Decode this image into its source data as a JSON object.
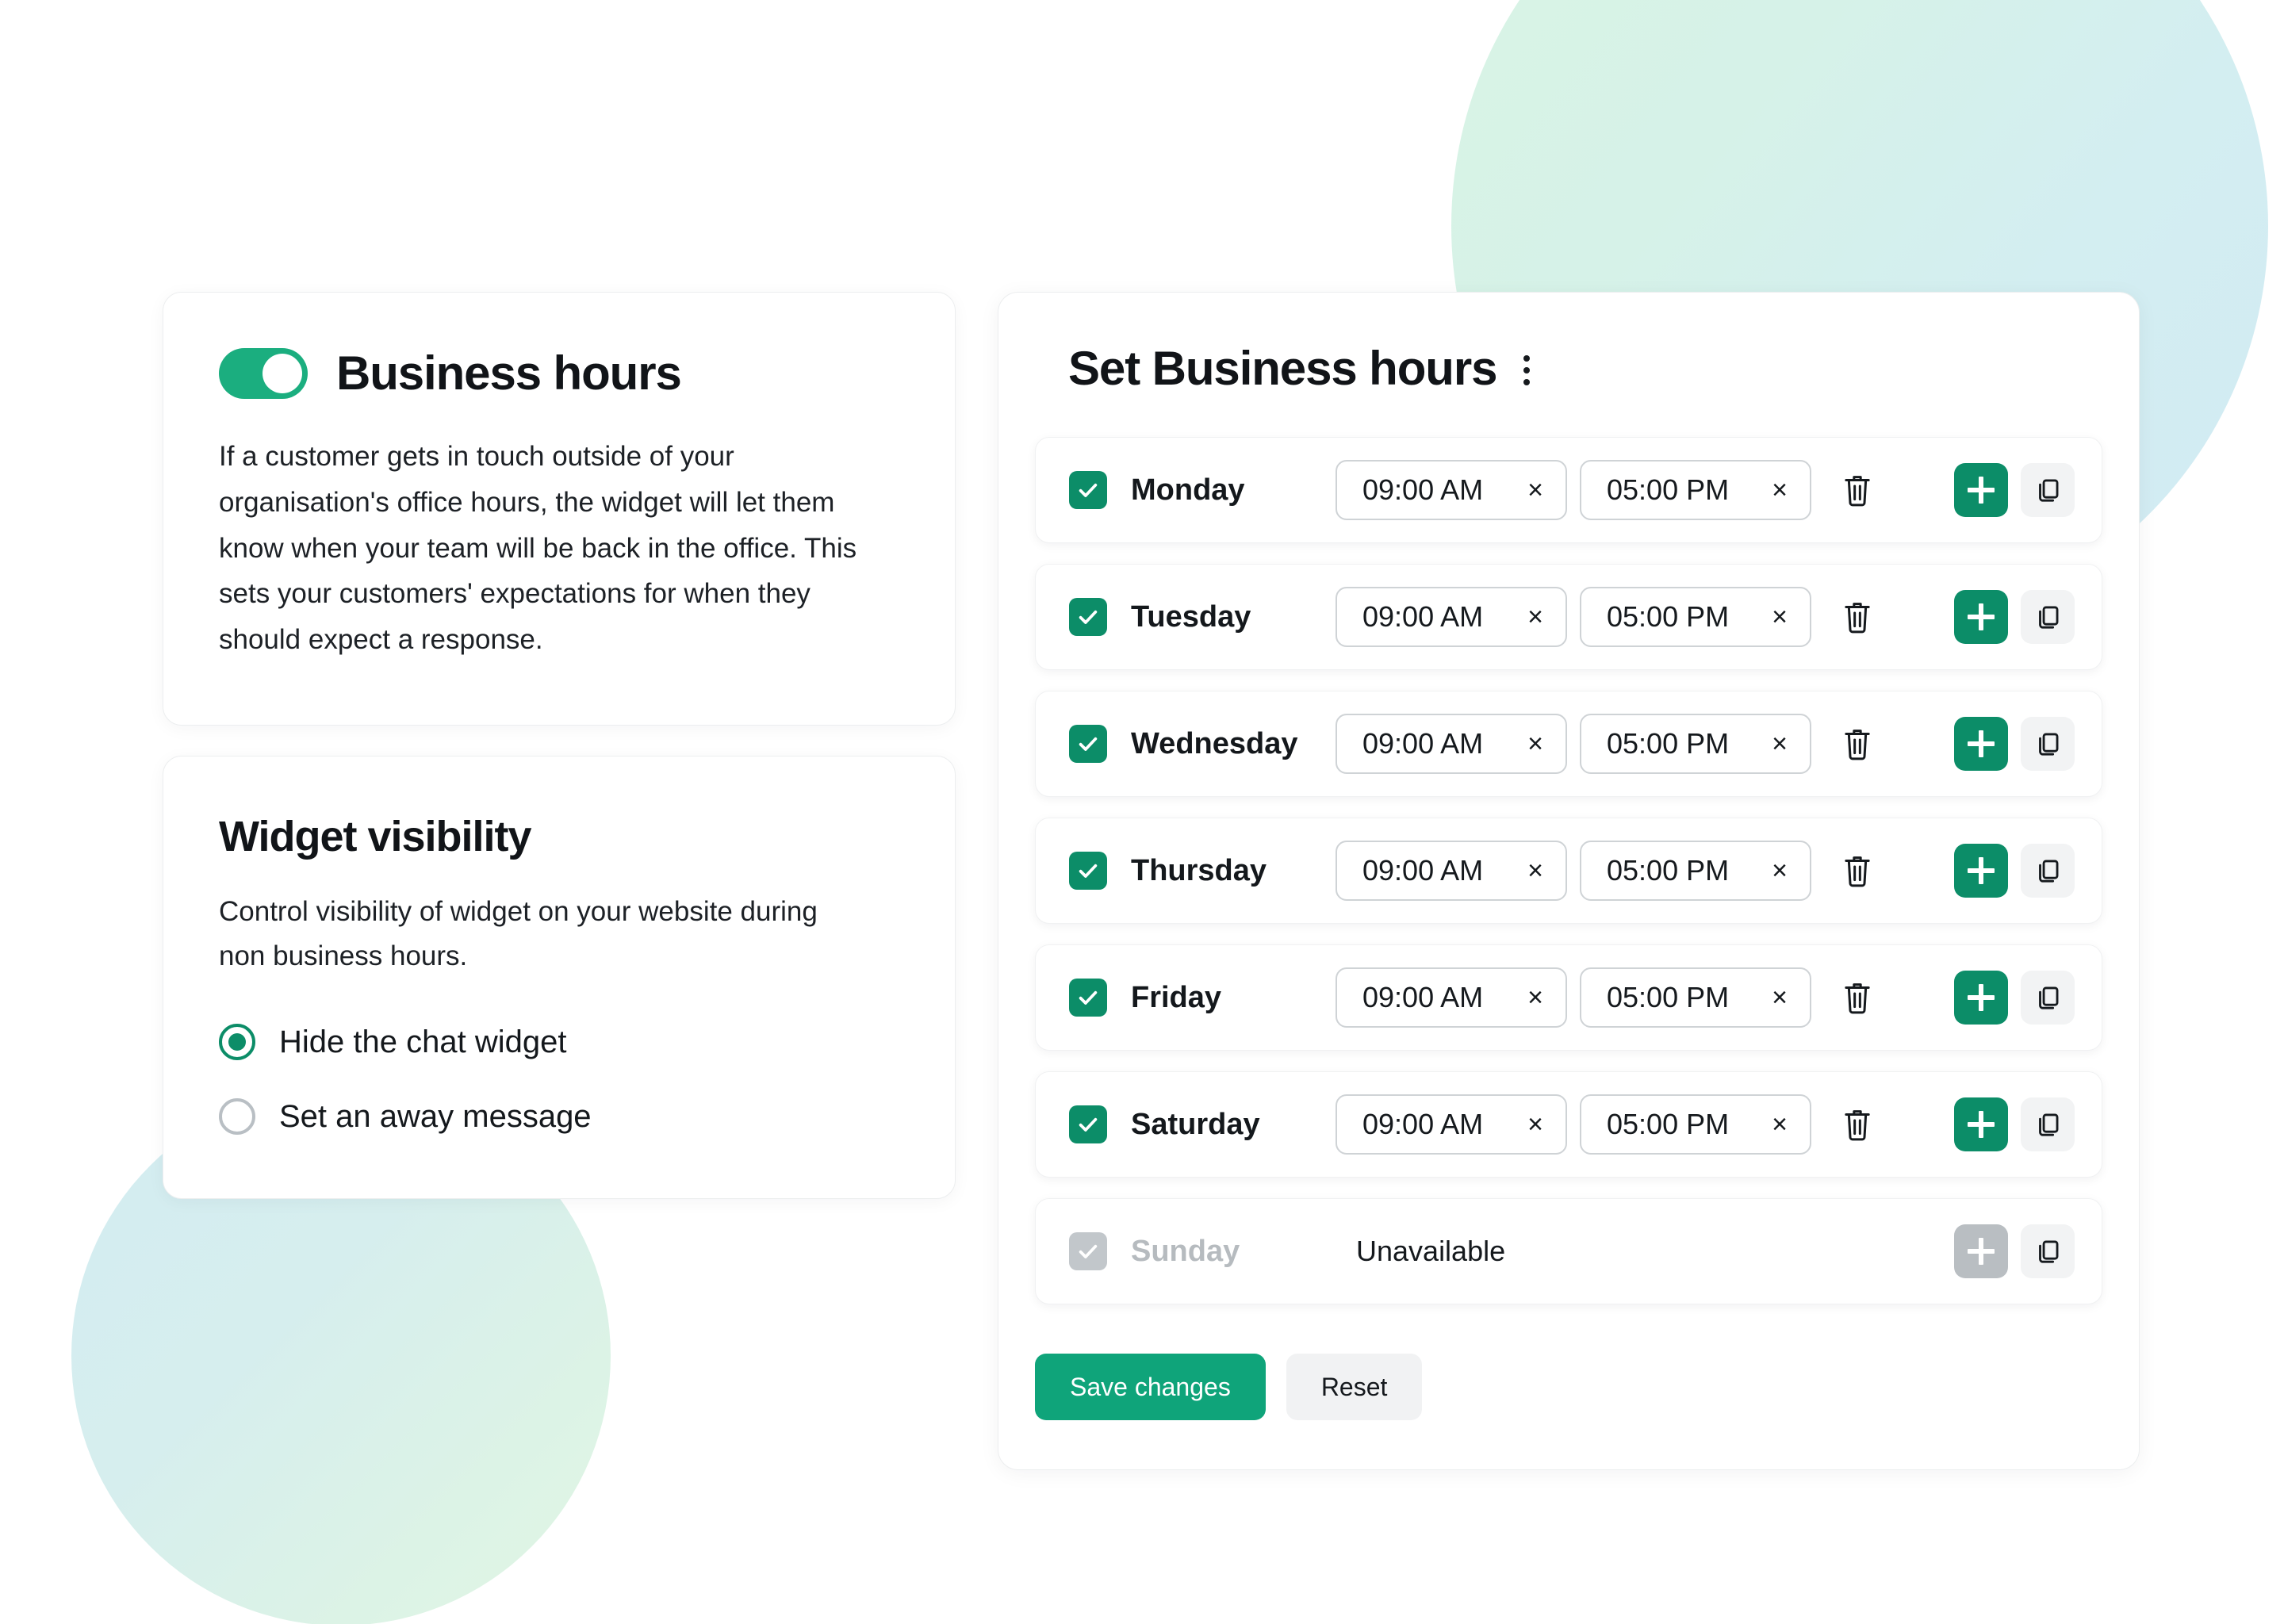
{
  "theme": {
    "accent_green": "#0c8d68",
    "toggle_green": "#1bae7f",
    "save_green": "#0fa47a",
    "disabled_grey": "#b9bec2",
    "text_dark": "#14181c"
  },
  "business_hours_card": {
    "toggle": {
      "state": "on",
      "label": "business-hours-toggle"
    },
    "title": "Business hours",
    "description": "If a customer gets in touch outside of your organisation's office hours, the widget will let them know when your team will be back in the office. This sets your customers' expectations for when they should expect a response."
  },
  "widget_visibility_card": {
    "title": "Widget visibility",
    "description": "Control visibility of widget on your website during non business hours.",
    "options": [
      {
        "label": "Hide the chat widget",
        "selected": true
      },
      {
        "label": "Set an away message",
        "selected": false
      }
    ]
  },
  "set_business_hours_panel": {
    "title": "Set Business hours",
    "menu_icon": "kebab-menu-icon",
    "rows": [
      {
        "day": "Monday",
        "enabled": true,
        "start": "09:00 AM",
        "end": "05:00 PM",
        "clear_glyph": "×"
      },
      {
        "day": "Tuesday",
        "enabled": true,
        "start": "09:00 AM",
        "end": "05:00 PM",
        "clear_glyph": "×"
      },
      {
        "day": "Wednesday",
        "enabled": true,
        "start": "09:00 AM",
        "end": "05:00 PM",
        "clear_glyph": "×"
      },
      {
        "day": "Thursday",
        "enabled": true,
        "start": "09:00 AM",
        "end": "05:00 PM",
        "clear_glyph": "×"
      },
      {
        "day": "Friday",
        "enabled": true,
        "start": "09:00 AM",
        "end": "05:00 PM",
        "clear_glyph": "×"
      },
      {
        "day": "Saturday",
        "enabled": true,
        "start": "09:00 AM",
        "end": "05:00 PM",
        "clear_glyph": "×"
      },
      {
        "day": "Sunday",
        "enabled": false,
        "unavailable_label": "Unavailable"
      }
    ],
    "row_icons": {
      "delete": "trash-icon",
      "add": "plus-icon",
      "duplicate": "copy-icon",
      "checkbox": "checkbox-checked-icon"
    },
    "footer": {
      "save_label": "Save changes",
      "reset_label": "Reset"
    }
  }
}
